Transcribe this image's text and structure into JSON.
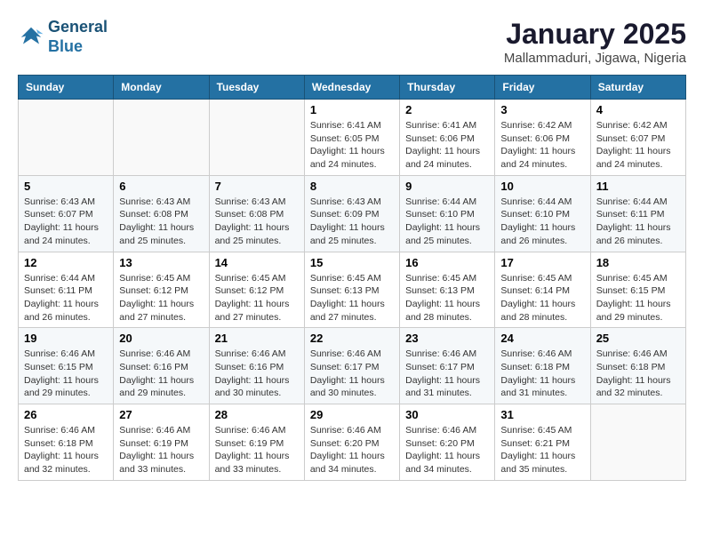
{
  "logo": {
    "line1": "General",
    "line2": "Blue"
  },
  "title": "January 2025",
  "subtitle": "Mallammaduri, Jigawa, Nigeria",
  "days_of_week": [
    "Sunday",
    "Monday",
    "Tuesday",
    "Wednesday",
    "Thursday",
    "Friday",
    "Saturday"
  ],
  "weeks": [
    [
      {
        "day": "",
        "info": ""
      },
      {
        "day": "",
        "info": ""
      },
      {
        "day": "",
        "info": ""
      },
      {
        "day": "1",
        "info": "Sunrise: 6:41 AM\nSunset: 6:05 PM\nDaylight: 11 hours and 24 minutes."
      },
      {
        "day": "2",
        "info": "Sunrise: 6:41 AM\nSunset: 6:06 PM\nDaylight: 11 hours and 24 minutes."
      },
      {
        "day": "3",
        "info": "Sunrise: 6:42 AM\nSunset: 6:06 PM\nDaylight: 11 hours and 24 minutes."
      },
      {
        "day": "4",
        "info": "Sunrise: 6:42 AM\nSunset: 6:07 PM\nDaylight: 11 hours and 24 minutes."
      }
    ],
    [
      {
        "day": "5",
        "info": "Sunrise: 6:43 AM\nSunset: 6:07 PM\nDaylight: 11 hours and 24 minutes."
      },
      {
        "day": "6",
        "info": "Sunrise: 6:43 AM\nSunset: 6:08 PM\nDaylight: 11 hours and 25 minutes."
      },
      {
        "day": "7",
        "info": "Sunrise: 6:43 AM\nSunset: 6:08 PM\nDaylight: 11 hours and 25 minutes."
      },
      {
        "day": "8",
        "info": "Sunrise: 6:43 AM\nSunset: 6:09 PM\nDaylight: 11 hours and 25 minutes."
      },
      {
        "day": "9",
        "info": "Sunrise: 6:44 AM\nSunset: 6:10 PM\nDaylight: 11 hours and 25 minutes."
      },
      {
        "day": "10",
        "info": "Sunrise: 6:44 AM\nSunset: 6:10 PM\nDaylight: 11 hours and 26 minutes."
      },
      {
        "day": "11",
        "info": "Sunrise: 6:44 AM\nSunset: 6:11 PM\nDaylight: 11 hours and 26 minutes."
      }
    ],
    [
      {
        "day": "12",
        "info": "Sunrise: 6:44 AM\nSunset: 6:11 PM\nDaylight: 11 hours and 26 minutes."
      },
      {
        "day": "13",
        "info": "Sunrise: 6:45 AM\nSunset: 6:12 PM\nDaylight: 11 hours and 27 minutes."
      },
      {
        "day": "14",
        "info": "Sunrise: 6:45 AM\nSunset: 6:12 PM\nDaylight: 11 hours and 27 minutes."
      },
      {
        "day": "15",
        "info": "Sunrise: 6:45 AM\nSunset: 6:13 PM\nDaylight: 11 hours and 27 minutes."
      },
      {
        "day": "16",
        "info": "Sunrise: 6:45 AM\nSunset: 6:13 PM\nDaylight: 11 hours and 28 minutes."
      },
      {
        "day": "17",
        "info": "Sunrise: 6:45 AM\nSunset: 6:14 PM\nDaylight: 11 hours and 28 minutes."
      },
      {
        "day": "18",
        "info": "Sunrise: 6:45 AM\nSunset: 6:15 PM\nDaylight: 11 hours and 29 minutes."
      }
    ],
    [
      {
        "day": "19",
        "info": "Sunrise: 6:46 AM\nSunset: 6:15 PM\nDaylight: 11 hours and 29 minutes."
      },
      {
        "day": "20",
        "info": "Sunrise: 6:46 AM\nSunset: 6:16 PM\nDaylight: 11 hours and 29 minutes."
      },
      {
        "day": "21",
        "info": "Sunrise: 6:46 AM\nSunset: 6:16 PM\nDaylight: 11 hours and 30 minutes."
      },
      {
        "day": "22",
        "info": "Sunrise: 6:46 AM\nSunset: 6:17 PM\nDaylight: 11 hours and 30 minutes."
      },
      {
        "day": "23",
        "info": "Sunrise: 6:46 AM\nSunset: 6:17 PM\nDaylight: 11 hours and 31 minutes."
      },
      {
        "day": "24",
        "info": "Sunrise: 6:46 AM\nSunset: 6:18 PM\nDaylight: 11 hours and 31 minutes."
      },
      {
        "day": "25",
        "info": "Sunrise: 6:46 AM\nSunset: 6:18 PM\nDaylight: 11 hours and 32 minutes."
      }
    ],
    [
      {
        "day": "26",
        "info": "Sunrise: 6:46 AM\nSunset: 6:18 PM\nDaylight: 11 hours and 32 minutes."
      },
      {
        "day": "27",
        "info": "Sunrise: 6:46 AM\nSunset: 6:19 PM\nDaylight: 11 hours and 33 minutes."
      },
      {
        "day": "28",
        "info": "Sunrise: 6:46 AM\nSunset: 6:19 PM\nDaylight: 11 hours and 33 minutes."
      },
      {
        "day": "29",
        "info": "Sunrise: 6:46 AM\nSunset: 6:20 PM\nDaylight: 11 hours and 34 minutes."
      },
      {
        "day": "30",
        "info": "Sunrise: 6:46 AM\nSunset: 6:20 PM\nDaylight: 11 hours and 34 minutes."
      },
      {
        "day": "31",
        "info": "Sunrise: 6:45 AM\nSunset: 6:21 PM\nDaylight: 11 hours and 35 minutes."
      },
      {
        "day": "",
        "info": ""
      }
    ]
  ]
}
